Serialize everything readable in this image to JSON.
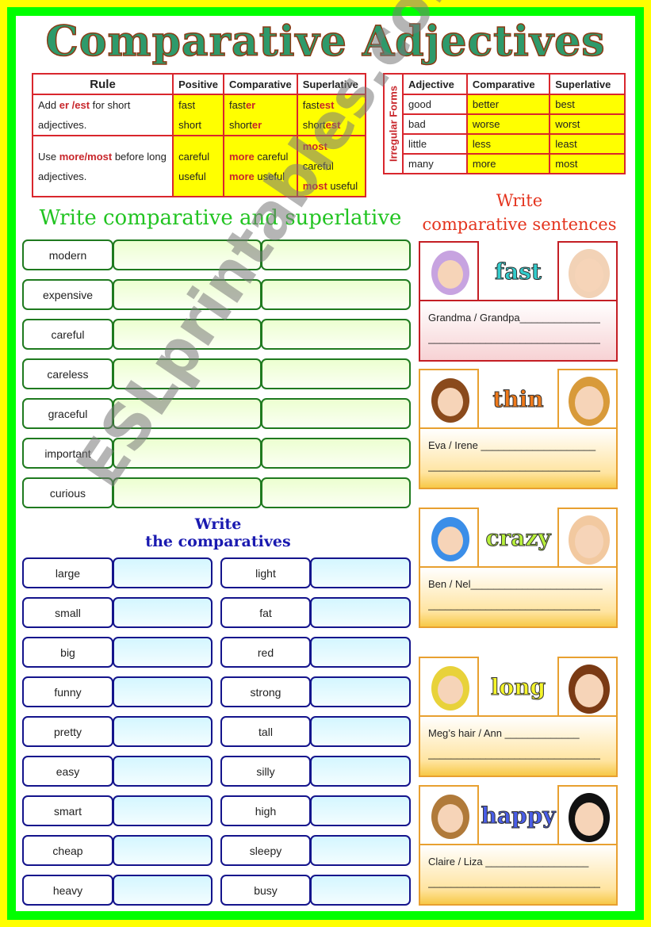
{
  "title": "Comparative Adjectives",
  "rule_table": {
    "headers": [
      "Rule",
      "Positive",
      "Comparative",
      "Superlative"
    ],
    "rows": [
      {
        "rule_pre": "Add ",
        "rule_hl": "er /est",
        "rule_post": " for short adjectives.",
        "positive": [
          "fast",
          "short"
        ],
        "comparative": [
          [
            "fast",
            "er"
          ],
          [
            "short",
            "er"
          ]
        ],
        "superlative": [
          [
            "fast",
            "est"
          ],
          [
            "short",
            "est"
          ]
        ]
      },
      {
        "rule_pre": "Use ",
        "rule_hl": "more/most",
        "rule_post": " before long adjectives.",
        "positive": [
          "careful",
          "useful"
        ],
        "comparative": [
          [
            "more",
            " careful"
          ],
          [
            "more",
            " useful"
          ]
        ],
        "superlative": [
          [
            "most",
            " careful"
          ],
          [
            "most",
            " useful"
          ]
        ]
      }
    ]
  },
  "irregular_table": {
    "side_label": "Irregular Forms",
    "headers": [
      "Adjective",
      "Comparative",
      "Superlative"
    ],
    "rows": [
      [
        "good",
        "better",
        "best"
      ],
      [
        "bad",
        "worse",
        "worst"
      ],
      [
        "little",
        "less",
        "least"
      ],
      [
        "many",
        "more",
        "most"
      ]
    ]
  },
  "section1": {
    "heading": "Write comparative and superlative",
    "words": [
      "modern",
      "expensive",
      "careful",
      "careless",
      "graceful",
      "important",
      "curious"
    ]
  },
  "section2": {
    "heading_line1": "Write",
    "heading_line2": "the comparatives",
    "left_words": [
      "large",
      "small",
      "big",
      "funny",
      "pretty",
      "easy",
      "smart",
      "cheap",
      "heavy"
    ],
    "right_words": [
      "light",
      "fat",
      "red",
      "strong",
      "tall",
      "silly",
      "high",
      "sleepy",
      "busy"
    ]
  },
  "section3": {
    "heading_line1": "Write",
    "heading_line2": "comparative sentences",
    "cards": [
      {
        "adjective": "fast",
        "prompt": "Grandma / Grandpa",
        "line1": "Grandma / Grandpa______________",
        "line2": "______________________________",
        "adj_color": "#33cccc",
        "style": "red"
      },
      {
        "adjective": "thin",
        "prompt": "Eva / Irene",
        "line1": "Eva / Irene ____________________",
        "line2": "______________________________",
        "adj_color": "#f07a1a",
        "style": "org"
      },
      {
        "adjective": "crazy",
        "prompt": "Ben / Nel",
        "line1": "Ben / Nel_______________________",
        "line2": "______________________________",
        "adj_color": "#b8f03c",
        "style": "org"
      },
      {
        "adjective": "long",
        "prompt": "Meg's hair / Ann",
        "line1": "Meg’s hair / Ann _____________",
        "line2": "______________________________",
        "adj_color": "#f5f52a",
        "style": "org"
      },
      {
        "adjective": "happy",
        "prompt": "Claire / Liza",
        "line1": "Claire / Liza __________________",
        "line2": "______________________________",
        "adj_color": "#4a5ee8",
        "style": "org"
      }
    ]
  },
  "watermark": "ESLprintables.com"
}
